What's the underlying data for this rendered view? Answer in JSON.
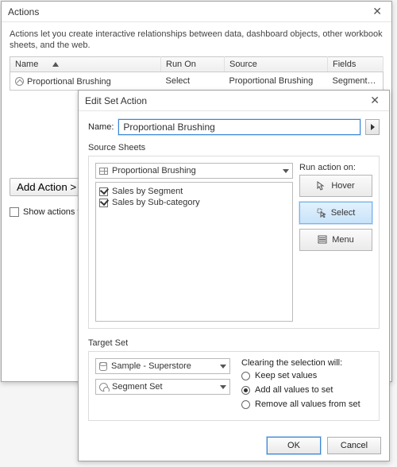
{
  "actions_dialog": {
    "title": "Actions",
    "intro": "Actions let you create interactive relationships between data, dashboard objects, other workbook sheets, and the web.",
    "columns": {
      "name": "Name",
      "run_on": "Run On",
      "source": "Source",
      "fields": "Fields"
    },
    "row": {
      "name": "Proportional Brushing",
      "run_on": "Select",
      "source": "Proportional Brushing",
      "fields": "Segment Set"
    },
    "add_action_label": "Add Action >",
    "show_actions_label": "Show actions for"
  },
  "edit_dialog": {
    "title": "Edit Set Action",
    "name_label": "Name:",
    "name_value": "Proportional Brushing",
    "source_sheets_label": "Source Sheets",
    "source_selected": "Proportional Brushing",
    "sheets": [
      {
        "label": "Sales by Segment",
        "checked": true
      },
      {
        "label": "Sales by Sub-category",
        "checked": true
      }
    ],
    "run_on": {
      "label": "Run action on:",
      "hover": "Hover",
      "select": "Select",
      "menu": "Menu",
      "selected": "select"
    },
    "target_set_label": "Target Set",
    "target_db": "Sample - Superstore",
    "target_set": "Segment Set",
    "clear_label": "Clearing the selection will:",
    "clear_options": {
      "keep": "Keep set values",
      "add": "Add all values to set",
      "remove": "Remove all values from set",
      "selected": "add"
    },
    "ok": "OK",
    "cancel": "Cancel"
  }
}
